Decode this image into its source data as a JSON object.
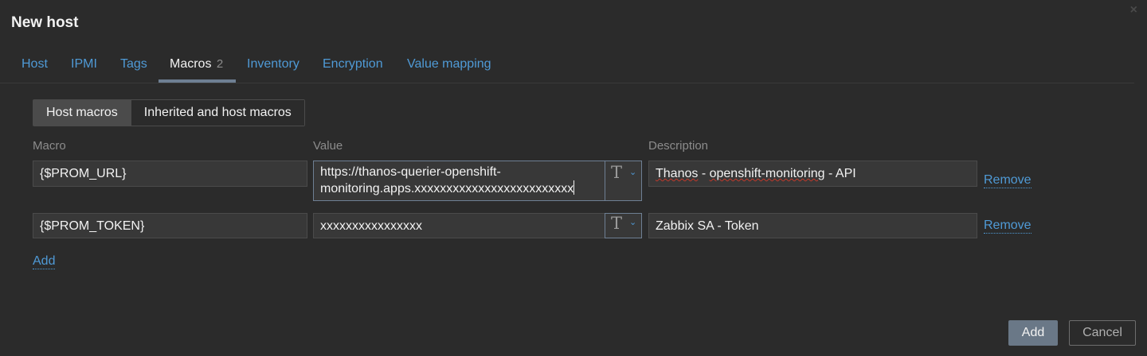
{
  "dialog": {
    "title": "New host",
    "close_icon": "×"
  },
  "tabs": [
    {
      "label": "Host"
    },
    {
      "label": "IPMI"
    },
    {
      "label": "Tags"
    },
    {
      "label": "Macros",
      "count": "2"
    },
    {
      "label": "Inventory"
    },
    {
      "label": "Encryption"
    },
    {
      "label": "Value mapping"
    }
  ],
  "segment": {
    "host_macros": "Host macros",
    "inherited": "Inherited and host macros"
  },
  "headers": {
    "macro": "Macro",
    "value": "Value",
    "description": "Description"
  },
  "macros": [
    {
      "macro": "{$PROM_URL}",
      "value": "https://thanos-querier-openshift-\nmonitoring.apps.xxxxxxxxxxxxxxxxxxxxxxxxx",
      "type_glyph": "T",
      "description_word": "Thanos",
      "description_sep1": " - ",
      "description_word2": "openshift-monitoring",
      "description_rest": " - API",
      "remove": "Remove"
    },
    {
      "macro": "{$PROM_TOKEN}",
      "value": "xxxxxxxxxxxxxxxx",
      "type_glyph": "T",
      "description": "Zabbix SA - Token",
      "remove": "Remove"
    }
  ],
  "add_link": "Add",
  "footer": {
    "add": "Add",
    "cancel": "Cancel"
  }
}
